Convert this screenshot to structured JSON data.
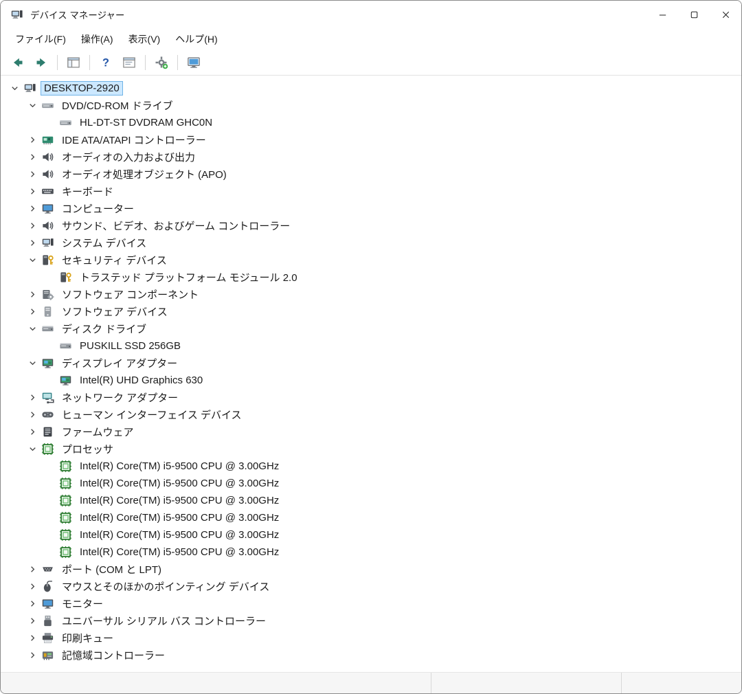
{
  "window": {
    "title": "デバイス マネージャー"
  },
  "menubar": {
    "items": [
      {
        "name": "menu-file",
        "label": "ファイル(F)"
      },
      {
        "name": "menu-action",
        "label": "操作(A)"
      },
      {
        "name": "menu-view",
        "label": "表示(V)"
      },
      {
        "name": "menu-help",
        "label": "ヘルプ(H)"
      }
    ]
  },
  "toolbar": {
    "buttons": [
      {
        "name": "back-button",
        "icon": "back"
      },
      {
        "name": "forward-button",
        "icon": "forward"
      },
      {
        "type": "sep"
      },
      {
        "name": "show-console-tree-button",
        "icon": "console-tree"
      },
      {
        "type": "sep"
      },
      {
        "name": "help-button",
        "icon": "help"
      },
      {
        "name": "properties-button",
        "icon": "properties"
      },
      {
        "type": "sep"
      },
      {
        "name": "scan-hardware-button",
        "icon": "gear-plus"
      },
      {
        "type": "sep"
      },
      {
        "name": "remote-computer-button",
        "icon": "monitor-frame"
      }
    ]
  },
  "tree": {
    "items": [
      {
        "label": "DESKTOP-2920",
        "level": 0,
        "state": "expanded",
        "icon": "computer",
        "selected": true
      },
      {
        "label": "DVD/CD-ROM ドライブ",
        "level": 1,
        "state": "expanded",
        "icon": "dvd"
      },
      {
        "label": "HL-DT-ST DVDRAM GHC0N",
        "level": 2,
        "state": "leaf",
        "icon": "dvd"
      },
      {
        "label": "IDE ATA/ATAPI コントローラー",
        "level": 1,
        "state": "collapsed",
        "icon": "board"
      },
      {
        "label": "オーディオの入力および出力",
        "level": 1,
        "state": "collapsed",
        "icon": "audio"
      },
      {
        "label": "オーディオ処理オブジェクト (APO)",
        "level": 1,
        "state": "collapsed",
        "icon": "audio"
      },
      {
        "label": "キーボード",
        "level": 1,
        "state": "collapsed",
        "icon": "keyboard"
      },
      {
        "label": "コンピューター",
        "level": 1,
        "state": "collapsed",
        "icon": "monitor"
      },
      {
        "label": "サウンド、ビデオ、およびゲーム コントローラー",
        "level": 1,
        "state": "collapsed",
        "icon": "audio"
      },
      {
        "label": "システム デバイス",
        "level": 1,
        "state": "collapsed",
        "icon": "computer"
      },
      {
        "label": "セキュリティ デバイス",
        "level": 1,
        "state": "expanded",
        "icon": "security"
      },
      {
        "label": "トラステッド プラットフォーム モジュール 2.0",
        "level": 2,
        "state": "leaf",
        "icon": "security"
      },
      {
        "label": "ソフトウェア コンポーネント",
        "level": 1,
        "state": "collapsed",
        "icon": "sw-component"
      },
      {
        "label": "ソフトウェア デバイス",
        "level": 1,
        "state": "collapsed",
        "icon": "sw-device"
      },
      {
        "label": "ディスク ドライブ",
        "level": 1,
        "state": "expanded",
        "icon": "disk"
      },
      {
        "label": "PUSKILL SSD 256GB",
        "level": 2,
        "state": "leaf",
        "icon": "disk"
      },
      {
        "label": "ディスプレイ アダプター",
        "level": 1,
        "state": "expanded",
        "icon": "display"
      },
      {
        "label": "Intel(R) UHD Graphics 630",
        "level": 2,
        "state": "leaf",
        "icon": "display"
      },
      {
        "label": "ネットワーク アダプター",
        "level": 1,
        "state": "collapsed",
        "icon": "network"
      },
      {
        "label": "ヒューマン インターフェイス デバイス",
        "level": 1,
        "state": "collapsed",
        "icon": "hid"
      },
      {
        "label": "ファームウェア",
        "level": 1,
        "state": "collapsed",
        "icon": "firmware"
      },
      {
        "label": "プロセッサ",
        "level": 1,
        "state": "expanded",
        "icon": "cpu"
      },
      {
        "label": "Intel(R) Core(TM) i5-9500 CPU @ 3.00GHz",
        "level": 2,
        "state": "leaf",
        "icon": "cpu"
      },
      {
        "label": "Intel(R) Core(TM) i5-9500 CPU @ 3.00GHz",
        "level": 2,
        "state": "leaf",
        "icon": "cpu"
      },
      {
        "label": "Intel(R) Core(TM) i5-9500 CPU @ 3.00GHz",
        "level": 2,
        "state": "leaf",
        "icon": "cpu"
      },
      {
        "label": "Intel(R) Core(TM) i5-9500 CPU @ 3.00GHz",
        "level": 2,
        "state": "leaf",
        "icon": "cpu"
      },
      {
        "label": "Intel(R) Core(TM) i5-9500 CPU @ 3.00GHz",
        "level": 2,
        "state": "leaf",
        "icon": "cpu"
      },
      {
        "label": "Intel(R) Core(TM) i5-9500 CPU @ 3.00GHz",
        "level": 2,
        "state": "leaf",
        "icon": "cpu"
      },
      {
        "label": "ポート (COM と LPT)",
        "level": 1,
        "state": "collapsed",
        "icon": "port"
      },
      {
        "label": "マウスとそのほかのポインティング デバイス",
        "level": 1,
        "state": "collapsed",
        "icon": "mouse"
      },
      {
        "label": "モニター",
        "level": 1,
        "state": "collapsed",
        "icon": "monitor"
      },
      {
        "label": "ユニバーサル シリアル バス コントローラー",
        "level": 1,
        "state": "collapsed",
        "icon": "usb"
      },
      {
        "label": "印刷キュー",
        "level": 1,
        "state": "collapsed",
        "icon": "printer"
      },
      {
        "label": "記憶域コントローラー",
        "level": 1,
        "state": "collapsed",
        "icon": "storage"
      }
    ]
  },
  "statusbar": {
    "sections": [
      "",
      "",
      ""
    ]
  }
}
